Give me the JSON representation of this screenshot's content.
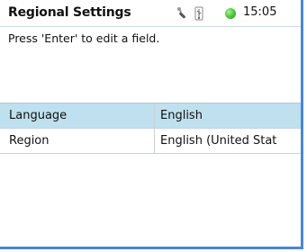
{
  "header": {
    "title": "Regional Settings",
    "time": "15:05",
    "icons": [
      "wrench-icon",
      "usb-icon",
      "battery-status-icon"
    ]
  },
  "hint": "Press 'Enter' to edit a field.",
  "settings": [
    {
      "label": "Language",
      "value": "English",
      "selected": true
    },
    {
      "label": "Region",
      "value": "English (United Stat",
      "selected": false
    }
  ],
  "colors": {
    "selected_row": "#bfe0ee",
    "frame_border": "#4a86d4",
    "status_green": "#45c23a"
  }
}
